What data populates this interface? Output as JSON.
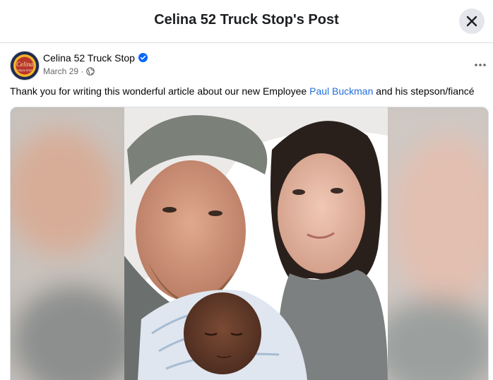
{
  "dialog": {
    "title": "Celina 52 Truck Stop's Post"
  },
  "post": {
    "author": "Celina 52 Truck Stop",
    "avatar_text": "Celina",
    "avatar_subtext": "TRUCK STOP",
    "date": "March 29",
    "separator": "·",
    "audience_icon": "globe-icon",
    "verified_icon": "verified-badge-icon",
    "more_icon": "more-options-icon",
    "text_before": "Thank you for writing this wonderful article about our new Employee ",
    "mention": "Paul Buckman",
    "text_after": " and his stepson/fiancé"
  },
  "colors": {
    "link": "#216fdb",
    "verified": "#0866ff",
    "secondary_text": "#65676b",
    "close_bg": "#e4e6eb"
  }
}
